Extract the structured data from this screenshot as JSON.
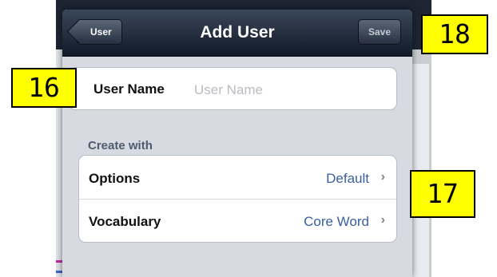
{
  "modal": {
    "title": "Add User",
    "back_label": "User",
    "save_label": "Save"
  },
  "user_name": {
    "label": "User Name",
    "placeholder": "User Name",
    "value": ""
  },
  "create_with": {
    "header": "Create with",
    "rows": [
      {
        "label": "Options",
        "value": "Default"
      },
      {
        "label": "Vocabulary",
        "value": "Core Word"
      }
    ]
  },
  "badges": [
    "16",
    "18",
    "17"
  ],
  "colors": {
    "navbar": "#1d2533",
    "badge": "#ffff00",
    "detail_value": "#3a5fa0"
  }
}
